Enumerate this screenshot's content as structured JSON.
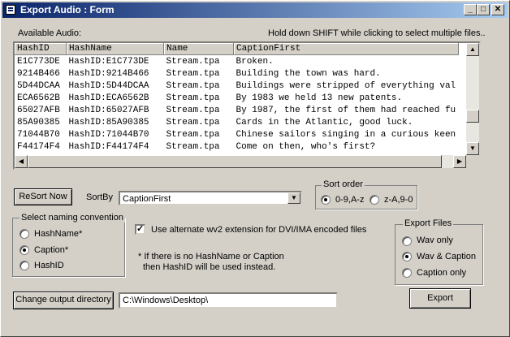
{
  "window": {
    "title": "Export Audio : Form",
    "min_glyph": "_",
    "max_glyph": "□",
    "close_glyph": "✕"
  },
  "labels": {
    "available_audio": "Available Audio:",
    "hint": "Hold down SHIFT while clicking to select multiple files..",
    "sort_by": "SortBy",
    "alt_ext": "Use alternate wv2 extension for DVI/IMA encoded files",
    "note_line1": "* If there is no HashName or Caption",
    "note_line2": "then HashID will be used instead."
  },
  "audio_list": {
    "columns": [
      "HashID",
      "HashName",
      "Name",
      "CaptionFirst"
    ],
    "rows": [
      [
        "E1C773DE",
        "HashID:E1C773DE",
        "Stream.tpa",
        "Broken."
      ],
      [
        "9214B466",
        "HashID:9214B466",
        "Stream.tpa",
        "Building the town was hard."
      ],
      [
        "5D44DCAA",
        "HashID:5D44DCAA",
        "Stream.tpa",
        "Buildings were stripped of everything val"
      ],
      [
        "ECA6562B",
        "HashID:ECA6562B",
        "Stream.tpa",
        "By 1983 we held 13 new patents."
      ],
      [
        "65027AFB",
        "HashID:65027AFB",
        "Stream.tpa",
        "By 1987, the first of them had reached fu"
      ],
      [
        "85A90385",
        "HashID:85A90385",
        "Stream.tpa",
        "Cards in the Atlantic, good luck."
      ],
      [
        "71044B70",
        "HashID:71044B70",
        "Stream.tpa",
        "Chinese sailors singing in a curious keen"
      ],
      [
        "F44174F4",
        "HashID:F44174F4",
        "Stream.tpa",
        "Come on then, who's first?"
      ]
    ]
  },
  "resort_button": "ReSort Now",
  "sort_by_value": "CaptionFirst",
  "sort_order": {
    "title": "Sort order",
    "options": [
      {
        "label": "0-9,A-z",
        "selected": true
      },
      {
        "label": "z-A,9-0",
        "selected": false
      }
    ]
  },
  "naming": {
    "title": "Select naming convention",
    "options": [
      {
        "label": "HashName*",
        "selected": false
      },
      {
        "label": "Caption*",
        "selected": true
      },
      {
        "label": "HashID",
        "selected": false
      }
    ]
  },
  "alt_ext_checked": true,
  "check_glyph": "✓",
  "arrows": {
    "up": "▲",
    "down": "▼",
    "left": "◀",
    "right": "▶"
  },
  "export_files": {
    "title": "Export Files",
    "options": [
      {
        "label": "Wav only",
        "selected": false
      },
      {
        "label": "Wav & Caption",
        "selected": true
      },
      {
        "label": "Caption only",
        "selected": false
      }
    ]
  },
  "output": {
    "button": "Change output directory",
    "path": "C:\\Windows\\Desktop\\"
  },
  "export_button": "Export"
}
